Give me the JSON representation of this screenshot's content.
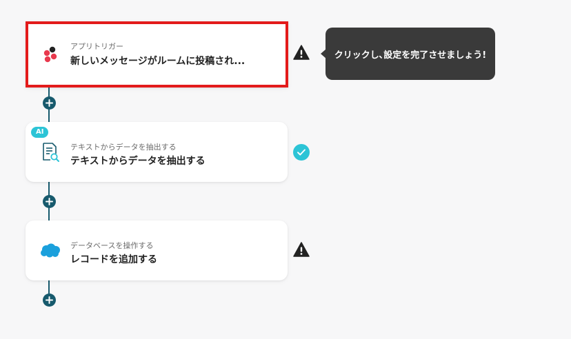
{
  "steps": [
    {
      "subtitle": "アプリトリガー",
      "title": "新しいメッセージがルームに投稿され...",
      "icon": "chatwork-icon",
      "status": "warning",
      "selected": true
    },
    {
      "badge": "AI",
      "subtitle": "テキストからデータを抽出する",
      "title": "テキストからデータを抽出する",
      "icon": "document-search-icon",
      "status": "complete"
    },
    {
      "subtitle": "データベースを操作する",
      "title": "レコードを追加する",
      "icon": "salesforce-cloud-icon",
      "status": "warning"
    }
  ],
  "tooltip": {
    "text": "クリックし､設定を完了させましょう!"
  },
  "colors": {
    "connector": "#175a6d",
    "selection_border": "#e31b1b",
    "complete": "#2cc4d6",
    "warning": "#222222",
    "tooltip_bg": "#3a3a3a"
  }
}
